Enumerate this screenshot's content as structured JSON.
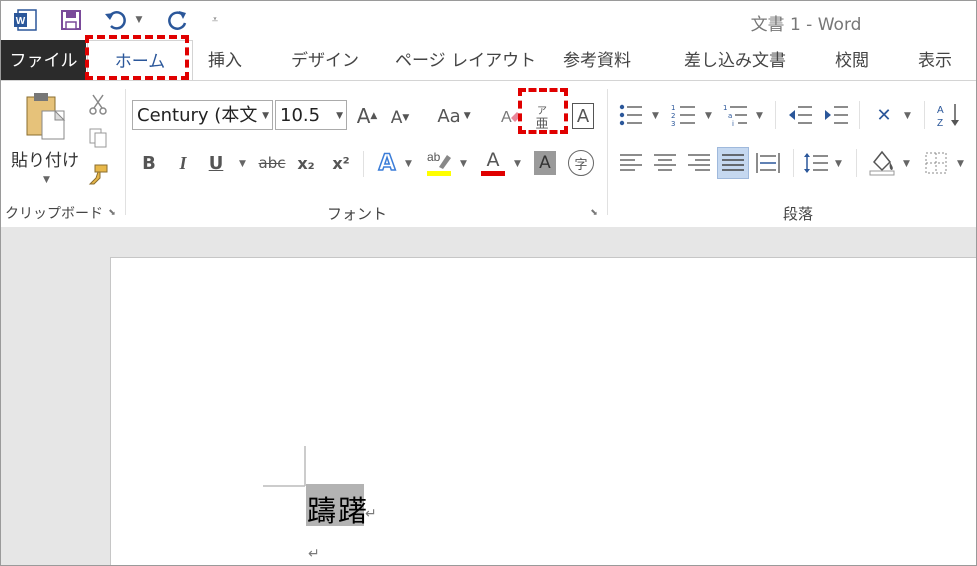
{
  "titlebar": {
    "title": "文書 1 - Word",
    "qat": [
      {
        "name": "word-logo-icon",
        "glyph": "W"
      },
      {
        "name": "save-icon",
        "glyph": "💾"
      },
      {
        "name": "undo-icon",
        "glyph": "↶"
      },
      {
        "name": "redo-icon",
        "glyph": "↺"
      },
      {
        "name": "customize-qat-icon",
        "glyph": "⩡"
      }
    ]
  },
  "tabs": {
    "file": "ファイル",
    "home": "ホーム",
    "insert": "挿入",
    "design": "デザイン",
    "page_layout": "ページ レイアウト",
    "references": "参考資料",
    "mailings": "差し込み文書",
    "review": "校閲",
    "view": "表示"
  },
  "ribbon": {
    "clipboard": {
      "group_label": "クリップボード",
      "paste_label": "貼り付け"
    },
    "font": {
      "group_label": "フォント",
      "font_name": "Century (本文",
      "font_size": "10.5",
      "change_case": "Aa",
      "bold": "B",
      "italic": "I",
      "underline": "U",
      "strike": "abc",
      "subscript": "x₂",
      "superscript": "x²",
      "char_border": "A",
      "enclose": "字",
      "ruby_top": "ア",
      "ruby_bottom": "亜"
    },
    "paragraph": {
      "group_label": "段落"
    }
  },
  "document": {
    "text": "躊躇",
    "para_mark": "↵"
  },
  "colors": {
    "accent": "#2b579a",
    "highlight_border": "#e00000",
    "file_tab_bg": "#2b2b2b"
  }
}
